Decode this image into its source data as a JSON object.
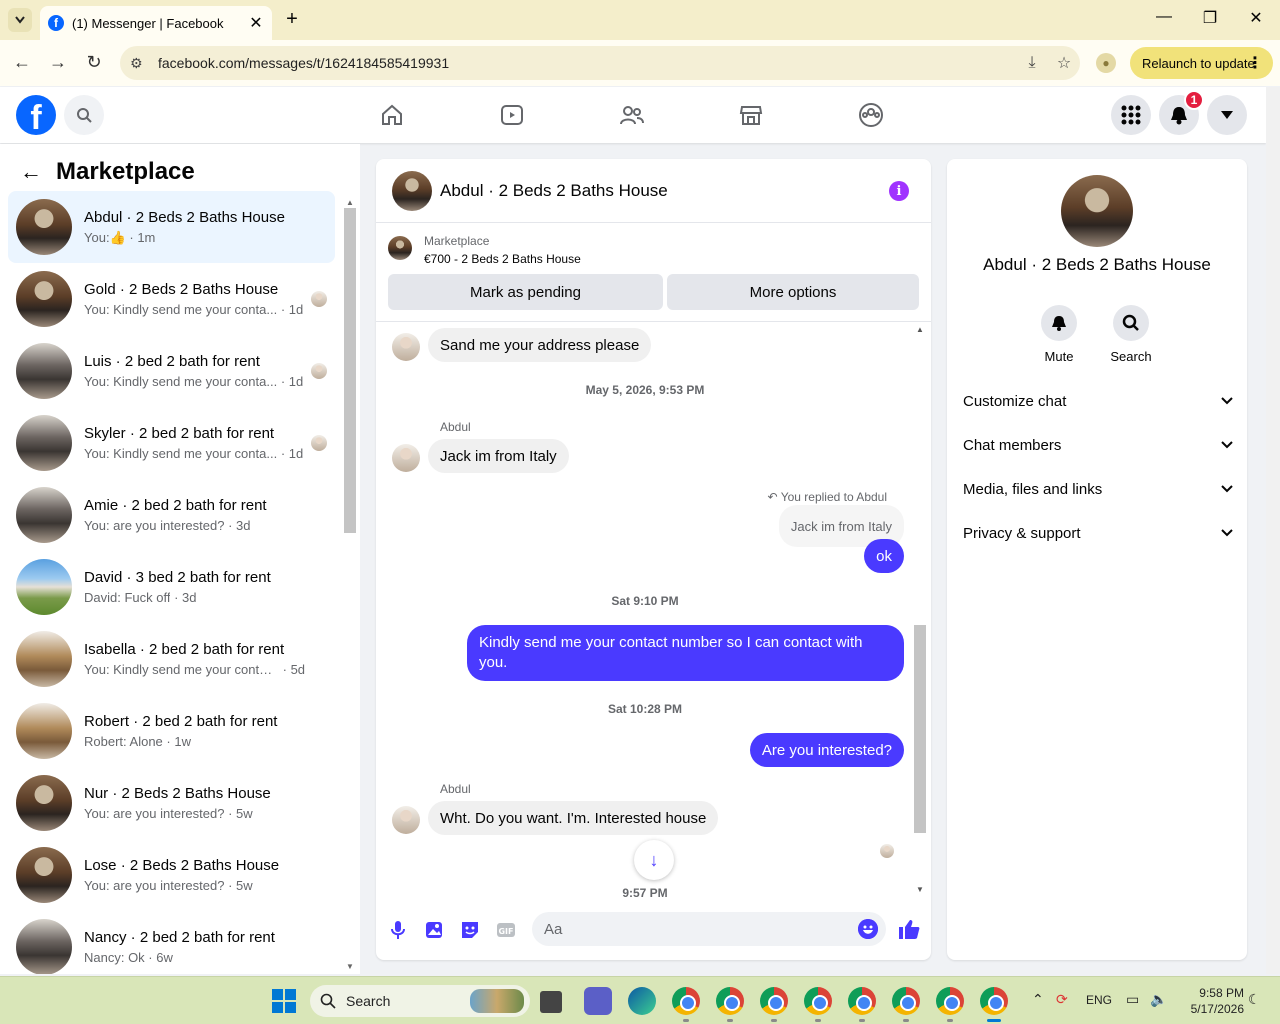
{
  "browser": {
    "tab_title": "(1) Messenger | Facebook",
    "url": "facebook.com/messages/t/1624184585419931",
    "relaunch_label": "Relaunch to update"
  },
  "fb_header": {
    "notification_count": "1",
    "nav": [
      "home-icon",
      "video-icon",
      "friends-icon",
      "marketplace-icon",
      "groups-icon"
    ]
  },
  "sidebar": {
    "title": "Marketplace",
    "conversations": [
      {
        "name": "Abdul · 2 Beds 2 Baths House",
        "preview": "You:",
        "time": "1m",
        "thumb": "👍",
        "active": true
      },
      {
        "name": "Gold · 2 Beds 2 Baths House",
        "preview": "You: Kindly send me your conta...",
        "time": "1d"
      },
      {
        "name": "Luis · 2 bed 2 bath for rent",
        "preview": "You: Kindly send me your conta...",
        "time": "1d"
      },
      {
        "name": "Skyler · 2 bed 2 bath for rent",
        "preview": "You: Kindly send me your conta...",
        "time": "1d"
      },
      {
        "name": "Amie · 2 bed 2 bath for rent",
        "preview": "You: are you interested?",
        "time": "3d"
      },
      {
        "name": "David · 3 bed 2 bath for rent",
        "preview": "David: Fuck off",
        "time": "3d"
      },
      {
        "name": "Isabella · 2 bed 2 bath for rent",
        "preview": "You: Kindly send me your contact n...",
        "time": "5d"
      },
      {
        "name": "Robert · 2 bed 2 bath for rent",
        "preview": "Robert: Alone",
        "time": "1w"
      },
      {
        "name": "Nur · 2 Beds 2 Baths House",
        "preview": "You: are you interested?",
        "time": "5w"
      },
      {
        "name": "Lose · 2 Beds 2 Baths House",
        "preview": "You: are you interested?",
        "time": "5w"
      },
      {
        "name": "Nancy · 2 bed 2 bath for rent",
        "preview": "Nancy: Ok",
        "time": "6w"
      }
    ]
  },
  "chat": {
    "title": "Abdul · 2 Beds 2 Baths House",
    "listing_label": "Marketplace",
    "listing_price": "€700 - 2 Beds 2 Baths House",
    "mark_pending": "Mark as pending",
    "more_options": "More options",
    "msg1": "Sand me your address please",
    "ts1": "May 5, 2026, 9:53 PM",
    "sender1": "Abdul",
    "msg2": "Jack im from Italy",
    "replied_label": "You replied to Abdul",
    "quote": "Jack im from Italy",
    "msg3": "ok",
    "ts2": "Sat 9:10 PM",
    "msg4": "Kindly send me your contact number so I can contact with you.",
    "ts3": "Sat 10:28 PM",
    "msg5": "Are you interested?",
    "sender2": "Abdul",
    "msg6": "Wht. Do you want. I'm. Interested house",
    "ts4": "9:57 PM",
    "composer_placeholder": "Aa"
  },
  "right_panel": {
    "name": "Abdul · 2 Beds 2 Baths House",
    "mute": "Mute",
    "search": "Search",
    "sections": [
      "Customize chat",
      "Chat members",
      "Media, files and links",
      "Privacy & support"
    ]
  },
  "taskbar": {
    "search": "Search",
    "lang": "ENG",
    "time": "9:58 PM",
    "date": "5/17/2026"
  },
  "colors": {
    "messenger_blue": "#4a3aff",
    "fb_blue": "#0866ff",
    "active_row": "#ebf5ff"
  }
}
